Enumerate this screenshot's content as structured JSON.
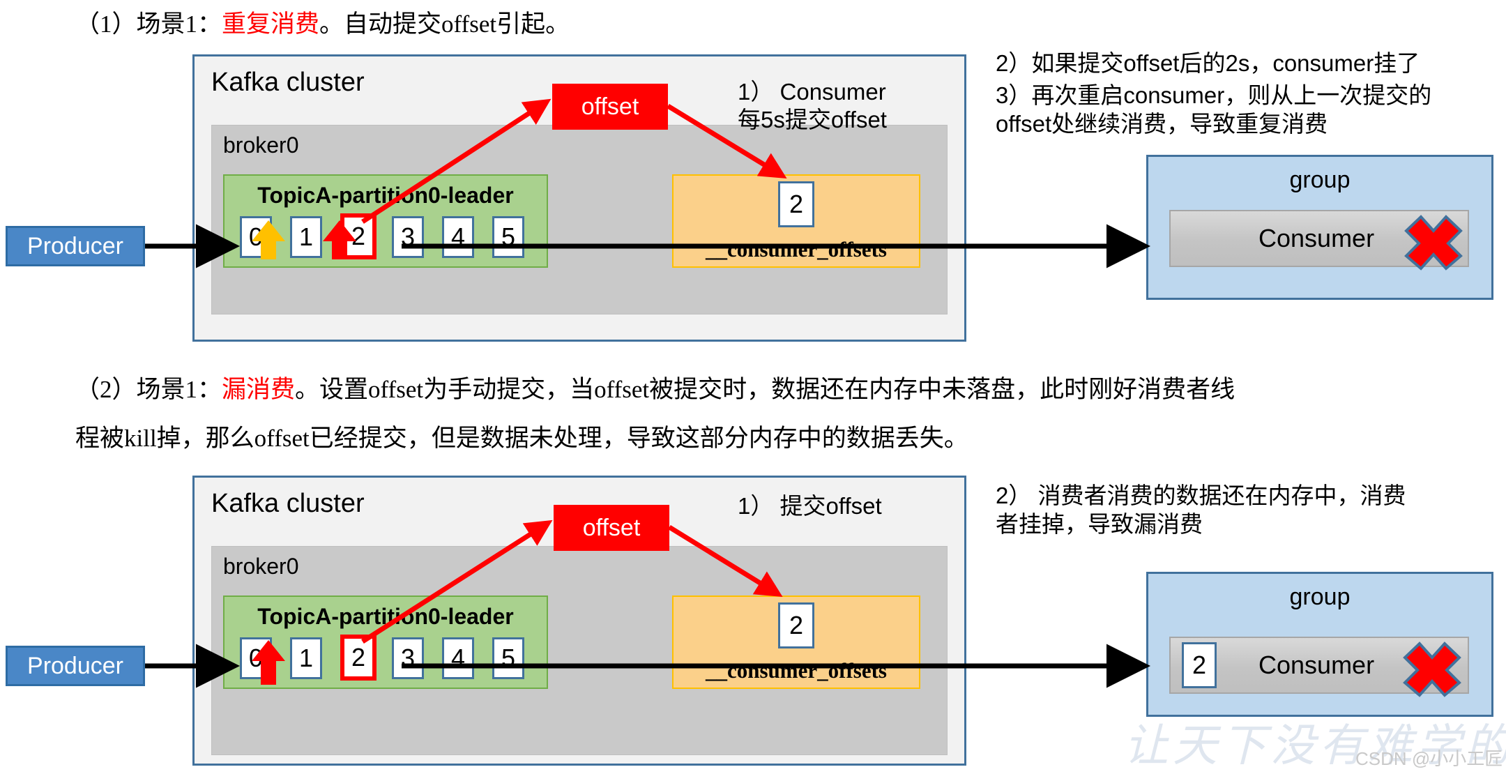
{
  "paragraphs": {
    "p1": {
      "prefix": "（1）场景1：",
      "highlight": "重复消费",
      "suffix": "。自动提交offset引起。"
    },
    "p2_line1": {
      "prefix": "（2）场景1：",
      "highlight": "漏消费",
      "suffix": "。设置offset为手动提交，当offset被提交时，数据还在内存中未落盘，此时刚好消费者线"
    },
    "p2_line2": {
      "text": "程被kill掉，那么offset已经提交，但是数据未处理，导致这部分内存中的数据丢失。"
    }
  },
  "diagram1": {
    "cluster_title": "Kafka cluster",
    "broker_title": "broker0",
    "topic_title": "TopicA-partition0-leader",
    "partitions": [
      "0",
      "1",
      "2",
      "3",
      "4",
      "5"
    ],
    "highlighted_partition": "2",
    "offset_box_label": "offset",
    "offsets_topic_title": "__consumer_offsets",
    "offsets_value": "2",
    "producer_label": "Producer",
    "group_title": "group",
    "consumer_label": "Consumer",
    "step1_note": "1）  Consumer\n每5s提交offset",
    "side_note_2": "2）如果提交offset后的2s，consumer挂了",
    "side_note_3": "3）再次重启consumer，则从上一次提交的\noffset处继续消费，导致重复消费",
    "colors": {
      "cluster_border": "#41719c",
      "cluster_fill": "#f2f2f2",
      "broker_fill": "#c9c9c9",
      "topic_fill": "#a9d18e",
      "topic_border": "#70ad47",
      "offsets_fill": "#fbd08a",
      "offsets_border": "#ffc000",
      "group_fill": "#bdd7ee",
      "producer_fill": "#4a87c7",
      "offset_box_fill": "#ff0000",
      "arrow_red": "#ff0000",
      "arrow_yellow": "#ffc000",
      "cross_red": "#ff0000"
    }
  },
  "diagram2": {
    "cluster_title": "Kafka cluster",
    "broker_title": "broker0",
    "topic_title": "TopicA-partition0-leader",
    "partitions": [
      "0",
      "1",
      "2",
      "3",
      "4",
      "5"
    ],
    "highlighted_partition": "2",
    "offset_box_label": "offset",
    "offsets_topic_title": "__consumer_offsets",
    "offsets_value": "2",
    "producer_label": "Producer",
    "group_title": "group",
    "consumer_label": "Consumer",
    "consumer_offset_value": "2",
    "step1_note": "1）  提交offset",
    "side_note_2": "2）  消费者消费的数据还在内存中，消费\n者挂掉，导致漏消费"
  },
  "watermark": {
    "text": "让天下没有难学的技术",
    "credit": "CSDN @小小工匠"
  }
}
